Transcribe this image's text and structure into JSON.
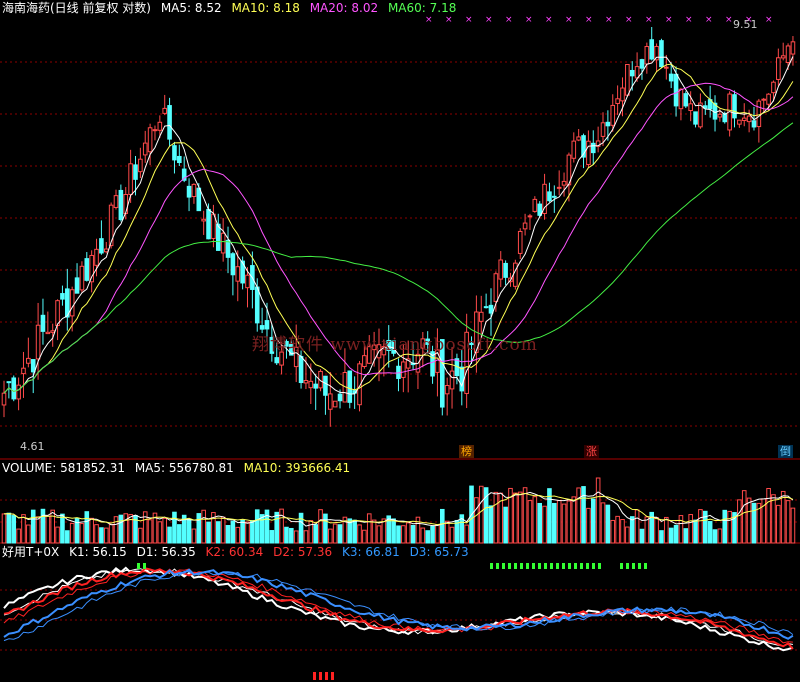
{
  "header": {
    "stock": "海南海药(日线 前复权 对数)",
    "ma": [
      {
        "label": "MA5: 8.52",
        "color": "#ffffff"
      },
      {
        "label": "MA10: 8.18",
        "color": "#ffff55"
      },
      {
        "label": "MA20: 8.02",
        "color": "#ff55ff"
      },
      {
        "label": "MA60: 7.18",
        "color": "#55ff55"
      }
    ]
  },
  "price_labels": {
    "high": "9.51",
    "low": "4.61"
  },
  "badges": [
    {
      "text": "榜",
      "color": "#ffaa00"
    },
    {
      "text": "涨",
      "color": "#ff4444"
    },
    {
      "text": "倒",
      "color": "#66ccff"
    }
  ],
  "volume_header": [
    {
      "label": "VOLUME: 581852.31",
      "color": "#ffffff"
    },
    {
      "label": "MA5: 556780.81",
      "color": "#ffffff"
    },
    {
      "label": "MA10: 393666.41",
      "color": "#ffff55"
    }
  ],
  "indicator_header": [
    {
      "label": "好用T+0X",
      "color": "#ffffff"
    },
    {
      "label": "K1: 56.15",
      "color": "#ffffff"
    },
    {
      "label": "D1: 56.35",
      "color": "#ffffff"
    },
    {
      "label": "K2: 60.34",
      "color": "#ff3333"
    },
    {
      "label": "D2: 57.36",
      "color": "#ff3333"
    },
    {
      "label": "K3: 66.81",
      "color": "#3399ff"
    },
    {
      "label": "D3: 65.73",
      "color": "#3399ff"
    }
  ],
  "watermark": "翔博软件 www.xiangbosoft.com",
  "colors": {
    "up": "#ff4a4a",
    "down": "#54ffff",
    "ma5": "#ffffff",
    "ma10": "#ffff55",
    "ma20": "#ff55ff",
    "ma60": "#44ee44",
    "k1": "#ffffff",
    "k2": "#ff2222",
    "k3": "#3a8fff",
    "grid": "#8b0000"
  },
  "chart_data": {
    "type": "candlestick",
    "ylim": [
      4.61,
      9.51
    ],
    "scale": "log",
    "anchors": [
      [
        0,
        5.0
      ],
      [
        5,
        5.3
      ],
      [
        12,
        5.8
      ],
      [
        18,
        6.3
      ],
      [
        24,
        6.9
      ],
      [
        28,
        7.5
      ],
      [
        32,
        8.1
      ],
      [
        36,
        7.4
      ],
      [
        40,
        6.9
      ],
      [
        45,
        6.4
      ],
      [
        50,
        6.0
      ],
      [
        54,
        5.6
      ],
      [
        60,
        5.2
      ],
      [
        66,
        5.0
      ],
      [
        72,
        5.1
      ],
      [
        78,
        5.3
      ],
      [
        86,
        5.4
      ],
      [
        90,
        5.1
      ],
      [
        94,
        5.2
      ],
      [
        98,
        5.7
      ],
      [
        104,
        6.3
      ],
      [
        110,
        6.9
      ],
      [
        116,
        7.5
      ],
      [
        122,
        7.8
      ],
      [
        126,
        8.4
      ],
      [
        130,
        8.9
      ],
      [
        134,
        9.1
      ],
      [
        138,
        8.4
      ],
      [
        142,
        8.0
      ],
      [
        146,
        8.1
      ],
      [
        150,
        8.2
      ],
      [
        154,
        8.1
      ],
      [
        158,
        8.5
      ],
      [
        162,
        9.3
      ]
    ]
  }
}
